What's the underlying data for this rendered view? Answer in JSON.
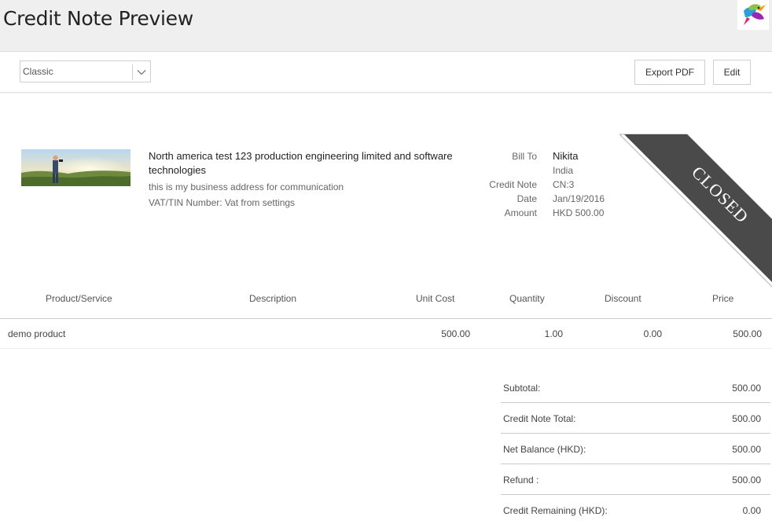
{
  "header": {
    "title": "Credit Note Preview"
  },
  "toolbar": {
    "template_selected": "Classic",
    "export_label": "Export PDF",
    "edit_label": "Edit"
  },
  "company": {
    "name": "North america test 123 production engineering limited and software technologies",
    "address": "this is my business address for communication",
    "vat": "VAT/TIN Number: Vat from settings"
  },
  "bill": {
    "labels": {
      "bill_to": "Bill To",
      "credit_note": "Credit Note",
      "date": "Date",
      "amount": "Amount"
    },
    "name": "Nikita",
    "country": "India",
    "credit_note": "CN:3",
    "date": "Jan/19/2016",
    "amount": "HKD 500.00"
  },
  "status_ribbon": "CLOSED",
  "table": {
    "headers": [
      "Product/Service",
      "Description",
      "Unit Cost",
      "Quantity",
      "Discount",
      "Price"
    ],
    "rows": [
      {
        "product": "demo product",
        "description": "",
        "unit_cost": "500.00",
        "quantity": "1.00",
        "discount": "0.00",
        "price": "500.00"
      }
    ]
  },
  "totals": [
    {
      "label": "Subtotal:",
      "value": "500.00"
    },
    {
      "label": "Credit Note Total:",
      "value": "500.00"
    },
    {
      "label": "Net Balance (HKD):",
      "value": "500.00"
    },
    {
      "label": "Refund :",
      "value": "500.00"
    },
    {
      "label": "Credit Remaining (HKD):",
      "value": "0.00"
    }
  ],
  "icons": {
    "logo": "hummingbird-logo-icon",
    "dropdown": "chevron-down-icon"
  },
  "colors": {
    "ribbon": "#4a4a4a",
    "header_bg": "#efefef"
  }
}
